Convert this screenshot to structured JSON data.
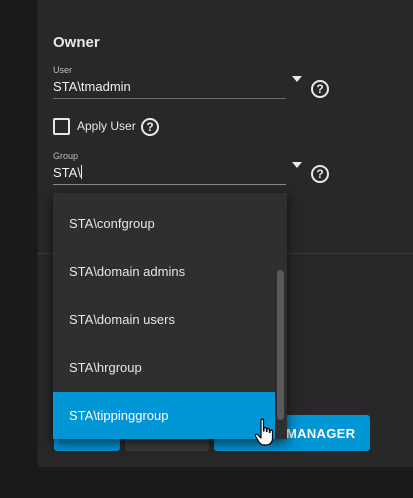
{
  "owner": {
    "title": "Owner",
    "user": {
      "label": "User",
      "value": "STA\\tmadmin"
    },
    "apply_user": {
      "label": "Apply User",
      "checked": false
    },
    "group": {
      "label": "Group",
      "value": "STA\\"
    }
  },
  "dropdown": {
    "options": [
      "STA\\confgroup",
      "STA\\domain admins",
      "STA\\domain users",
      "STA\\hrgroup",
      "STA\\tippinggroup"
    ],
    "selected": "STA\\tippinggroup"
  },
  "buttons": {
    "acl_manager_label_visible": "MANAGER"
  },
  "icons": {
    "help": "help-circle-icon",
    "dropdown": "chevron-down-icon",
    "cursor": "hand-pointer-icon"
  },
  "colors": {
    "accent": "#0095d5",
    "panel": "#282828",
    "background": "#1a1a1a"
  }
}
